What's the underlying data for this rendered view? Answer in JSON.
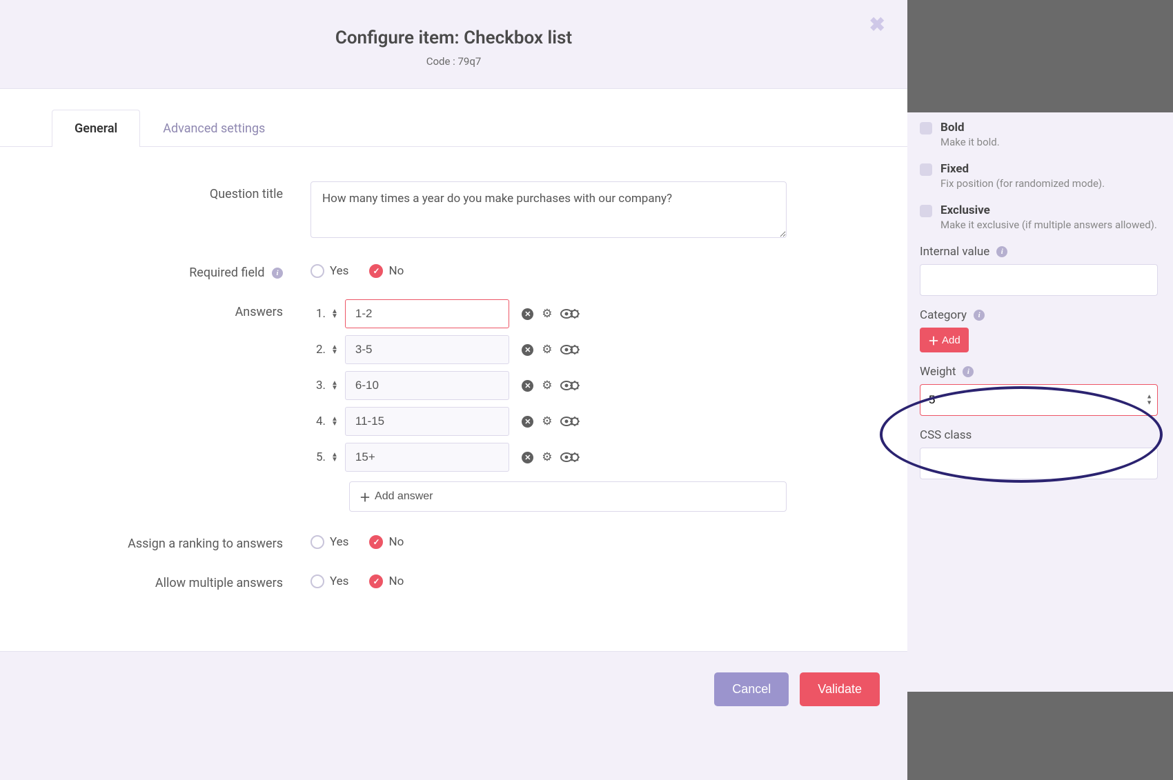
{
  "header": {
    "title": "Configure item: Checkbox list",
    "code_label": "Code : 79q7"
  },
  "tabs": {
    "general": "General",
    "advanced": "Advanced settings"
  },
  "form": {
    "question_title_label": "Question title",
    "question_title_value": "How many times a year do you make purchases with our company?",
    "required_field_label": "Required field",
    "answers_label": "Answers",
    "ranking_label": "Assign a ranking to answers",
    "multiple_label": "Allow multiple answers",
    "yes": "Yes",
    "no": "No",
    "add_answer": "Add answer",
    "answers": [
      {
        "num": "1.",
        "value": "1-2"
      },
      {
        "num": "2.",
        "value": "3-5"
      },
      {
        "num": "3.",
        "value": "6-10"
      },
      {
        "num": "4.",
        "value": "11-15"
      },
      {
        "num": "5.",
        "value": "15+"
      }
    ]
  },
  "footer": {
    "cancel": "Cancel",
    "validate": "Validate"
  },
  "side": {
    "bold_title": "Bold",
    "bold_desc": "Make it bold.",
    "fixed_title": "Fixed",
    "fixed_desc": "Fix position (for randomized mode).",
    "exclusive_title": "Exclusive",
    "exclusive_desc": "Make it exclusive (if multiple answers allowed).",
    "internal_value_label": "Internal value",
    "internal_value": "",
    "category_label": "Category",
    "add": "Add",
    "weight_label": "Weight",
    "weight_value": "5",
    "css_label": "CSS class",
    "css_value": ""
  }
}
